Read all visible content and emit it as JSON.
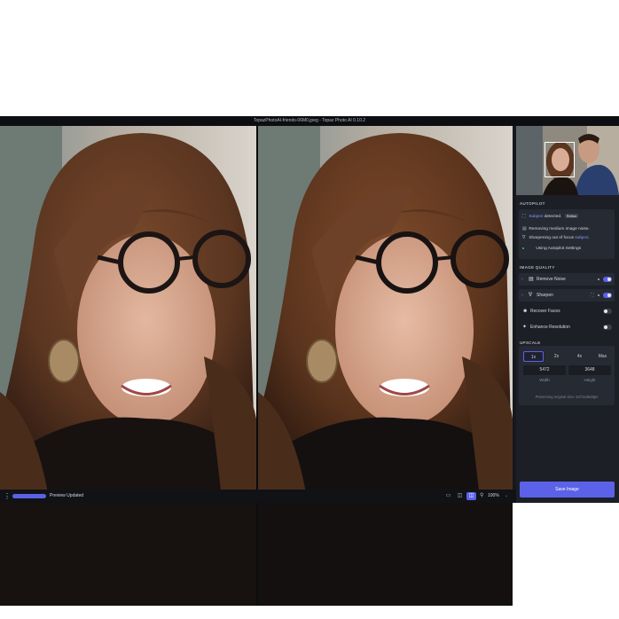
{
  "window": {
    "title": "TopazPhotoAI-friends-06M0.jpeg - Topaz Photo AI 0.10.2"
  },
  "colors": {
    "accent": "#5b62e8",
    "panel_bg": "#1c1f26",
    "card_bg": "#262a33",
    "app_bg": "#16181d"
  },
  "autopilot": {
    "title": "AUTOPILOT",
    "subject_word": "Subject",
    "detected_text": "detected.",
    "refine_label": "Refine",
    "noise_text": "Removing medium image noise.",
    "sharpen_text": "Sharpening out of focus",
    "sharpen_subject": "subject.",
    "settings_text": "Using Autopilot Settings"
  },
  "image_quality": {
    "title": "IMAGE QUALITY",
    "features": [
      {
        "label": "Remove Noise",
        "icon": "noise-icon",
        "enabled": true
      },
      {
        "label": "Sharpen",
        "icon": "sharpen-icon",
        "enabled": true
      },
      {
        "label": "Recover Faces",
        "icon": "face-icon",
        "enabled": false
      },
      {
        "label": "Enhance Resolution",
        "icon": "enhance-icon",
        "enabled": false
      }
    ]
  },
  "upscale": {
    "title": "UPSCALE",
    "scales": [
      "1x",
      "2x",
      "4x",
      "Max"
    ],
    "selected_scale": "1x",
    "width": "5472",
    "height": "3648",
    "width_label": "Width",
    "height_label": "Height",
    "note": "Preserving original size: 5472x3648px"
  },
  "bottom": {
    "status": "Preview Updated",
    "progress": 1.0,
    "zoom": "100%"
  },
  "save_label": "Save Image"
}
